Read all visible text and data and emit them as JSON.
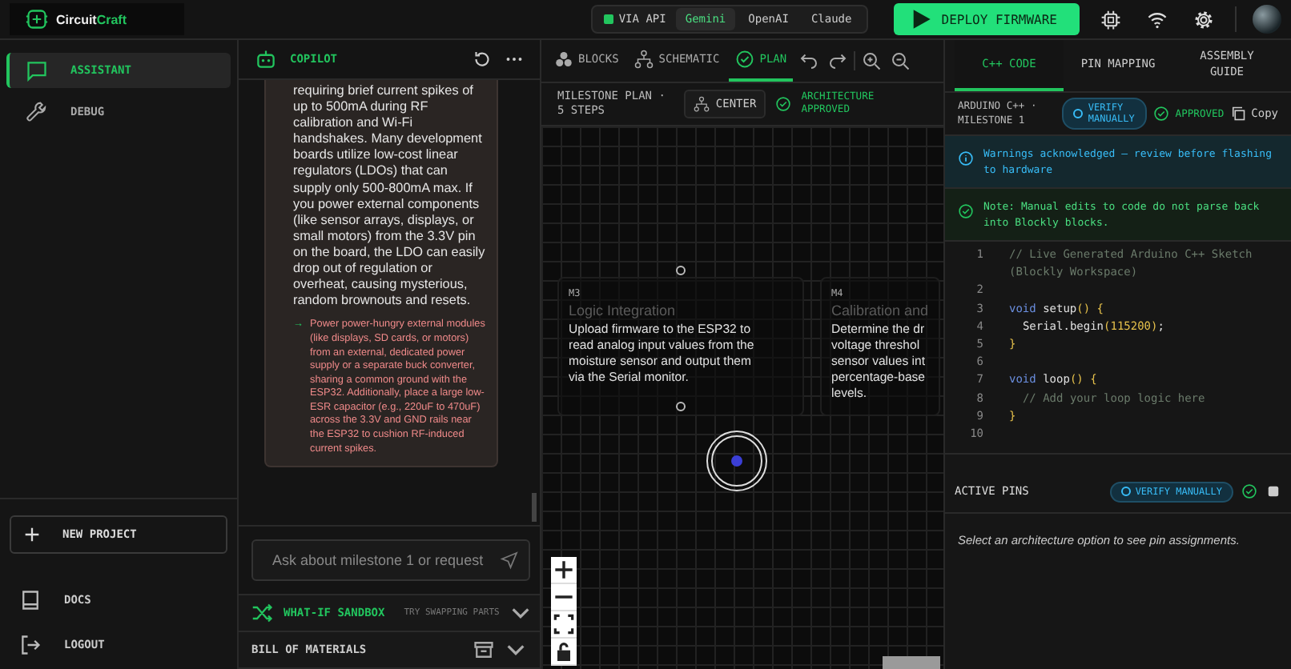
{
  "brand": {
    "name_part1": "Circuit",
    "name_part2": "Craft"
  },
  "model_switch": {
    "label": "VIA API",
    "options": [
      {
        "label": "Gemini",
        "selected": true
      },
      {
        "label": "OpenAI",
        "selected": false
      },
      {
        "label": "Claude",
        "selected": false
      }
    ]
  },
  "deploy_button": "DEPLOY FIRMWARE",
  "sidebar": {
    "items": [
      {
        "label": "ASSISTANT",
        "selected": true
      },
      {
        "label": "DEBUG",
        "selected": false
      }
    ],
    "new_project": "NEW PROJECT",
    "footer": [
      {
        "label": "DOCS"
      },
      {
        "label": "LOGOUT"
      }
    ]
  },
  "copilot": {
    "title": "COPILOT",
    "message": "requiring brief current spikes of up to 500mA during RF calibration and Wi-Fi handshakes. Many development boards utilize low-cost linear regulators (LDOs) that can supply only 500-800mA max. If you power external components (like sensor arrays, displays, or small motors) from the 3.3V pin on the board, the LDO can easily drop out of regulation or overheat, causing mysterious, random brownouts and resets.",
    "bullets": [
      {
        "marker": "→",
        "text": "Power power-hungry external modules (like displays, SD cards, or motors) from an external, dedicated power supply or a separate buck converter, sharing a common ground with the ESP32. Additionally, place a large low-ESR capacitor (e.g., 220uF to 470uF) across the 3.3V and GND rails near the ESP32 to cushion RF-induced current spikes."
      }
    ],
    "input": {
      "placeholder": "Ask about milestone 1 or request"
    },
    "sandbox": {
      "title": "WHAT-IF SANDBOX",
      "hint": "TRY SWAPPING PARTS",
      "expanded": false
    },
    "bom": {
      "title": "BILL OF MATERIALS",
      "expanded": false
    }
  },
  "canvas": {
    "tabs": [
      {
        "label": "BLOCKS",
        "selected": false
      },
      {
        "label": "SCHEMATIC",
        "selected": false
      },
      {
        "label": "PLAN",
        "selected": true
      }
    ],
    "header": "MILESTONE PLAN · 5 STEPS",
    "center_button": "CENTER",
    "status": "ARCHITECTURE APPROVED",
    "milestones": [
      {
        "id": "M3",
        "title": "Logic Integration",
        "lines": [
          "Upload firmware to the ESP32 to",
          "read analog input values from the",
          "moisture sensor and output them",
          "via the Serial monitor."
        ]
      },
      {
        "id": "M4",
        "title": "Calibration and",
        "lines": [
          "Determine the dr",
          "voltage threshol",
          "sensor values int",
          "percentage-base",
          "levels."
        ]
      }
    ]
  },
  "code_panel": {
    "tabs": [
      {
        "label": "C++ CODE",
        "selected": true
      },
      {
        "label": "PIN MAPPING",
        "selected": false
      },
      {
        "label": "ASSEMBLY GUIDE",
        "selected": false
      }
    ],
    "title": "ARDUINO C++ · MILESTONE 1",
    "verify": "VERIFY MANUALLY",
    "approved": "APPROVED",
    "copy": "Copy",
    "banners": [
      {
        "kind": "info",
        "text": "Warnings acknowledged — review before flashing to hardware"
      },
      {
        "kind": "note",
        "text": "Note: Manual edits to code do not parse back into Blockly blocks."
      }
    ],
    "lines": [
      {
        "n": "1",
        "tokens": [
          {
            "kind": "comment",
            "t": "// Live Generated Arduino C++ Sketch (Blockly Workspace)"
          }
        ]
      },
      {
        "n": "2"
      },
      {
        "n": "3",
        "tokens": [
          {
            "kind": "keyword",
            "t": "void"
          },
          {
            "kind": "plain",
            "t": " setup"
          },
          {
            "kind": "bracket",
            "t": "() {"
          }
        ]
      },
      {
        "n": "4",
        "tokens": [
          {
            "kind": "plain",
            "t": "  Serial.begin"
          },
          {
            "kind": "bracket",
            "t": "("
          },
          {
            "kind": "number",
            "t": "115200"
          },
          {
            "kind": "bracket",
            "t": ")"
          },
          {
            "kind": "plain",
            "t": ";"
          }
        ]
      },
      {
        "n": "5",
        "tokens": [
          {
            "kind": "bracket",
            "t": "}"
          }
        ]
      },
      {
        "n": "6"
      },
      {
        "n": "7",
        "tokens": [
          {
            "kind": "keyword",
            "t": "void"
          },
          {
            "kind": "plain",
            "t": " loop"
          },
          {
            "kind": "bracket",
            "t": "() {"
          }
        ]
      },
      {
        "n": "8",
        "tokens": [
          {
            "kind": "comment",
            "t": "  // Add your loop logic here"
          }
        ]
      },
      {
        "n": "9",
        "tokens": [
          {
            "kind": "bracket",
            "t": "}"
          }
        ]
      },
      {
        "n": "10"
      }
    ],
    "pins": {
      "title": "ACTIVE PINS",
      "verify": "VERIFY MANUALLY",
      "empty": "Select an architecture option to see pin assignments."
    }
  }
}
